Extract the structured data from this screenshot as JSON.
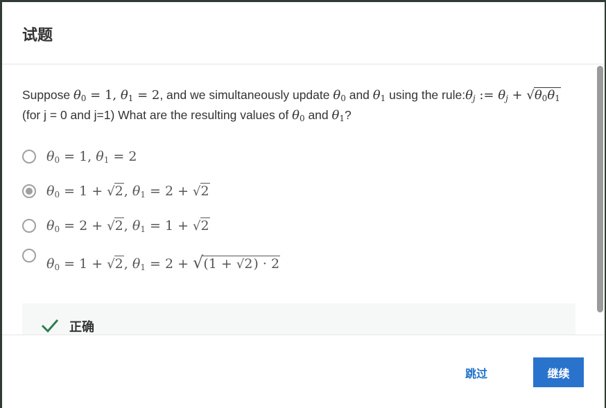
{
  "dialog": {
    "title": "试题"
  },
  "question": {
    "prefix": "Suppose ",
    "mid1": ", and we simultaneously update ",
    "mid2": " and ",
    "mid3": " using the rule:",
    "mid4": " (for j = 0 and j=1) What are the resulting values of ",
    "mid5": " and ",
    "suffix": "?"
  },
  "options": [
    {
      "selected": false
    },
    {
      "selected": true
    },
    {
      "selected": false
    },
    {
      "selected": false
    }
  ],
  "feedback": {
    "label": "正确",
    "icon": "check-icon",
    "color": "#2e7d4f"
  },
  "footer": {
    "skip_label": "跳过",
    "continue_label": "继续"
  },
  "colors": {
    "accent": "#2a73cc",
    "link": "#2172c9"
  }
}
